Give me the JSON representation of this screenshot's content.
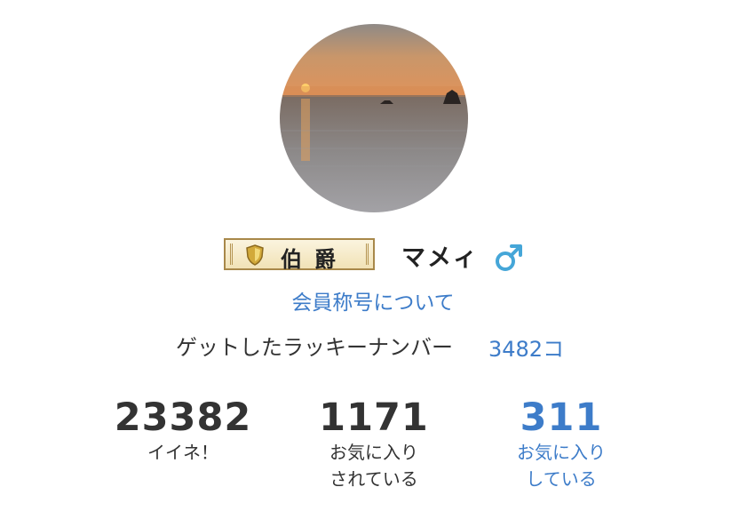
{
  "profile": {
    "avatar_alt": "sunset-over-sea",
    "rank_badge": "伯爵",
    "username": "マメィ",
    "gender": "male-icon",
    "title_link": "会員称号について"
  },
  "lucky": {
    "label": "ゲットしたラッキーナンバー",
    "count": "3482コ"
  },
  "stats": [
    {
      "value": "23382",
      "label_line1": "イイネ！",
      "label_line2": ""
    },
    {
      "value": "1171",
      "label_line1": "お気に入り",
      "label_line2": "されている"
    },
    {
      "value": "311",
      "label_line1": "お気に入り",
      "label_line2": "している"
    }
  ],
  "colors": {
    "link": "#3d7cc9",
    "text": "#333333",
    "gender": "#45a6d8",
    "badge_border": "#a8884a"
  }
}
